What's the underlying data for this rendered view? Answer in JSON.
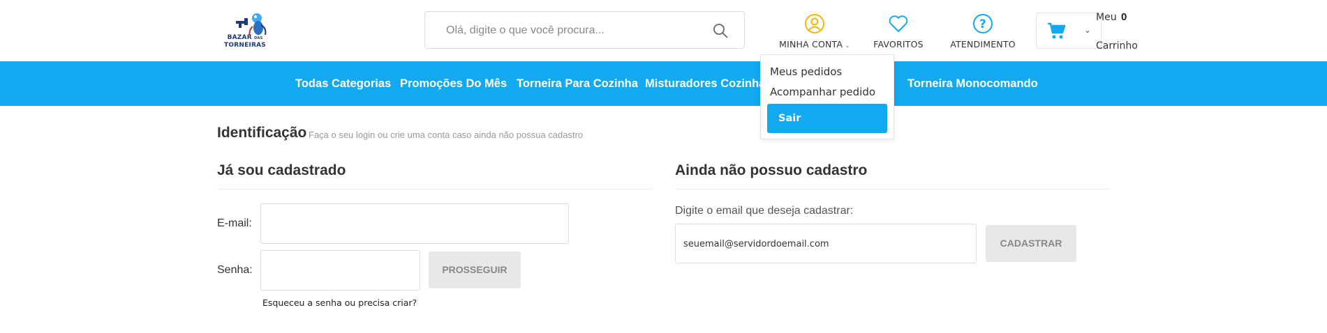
{
  "logo": {
    "line1": "BAZAR",
    "line1_small": "DAS",
    "line2": "TORNEIRAS"
  },
  "search": {
    "placeholder": "Olá, digite o que você procura..."
  },
  "header": {
    "account_label": "MINHA CONTA",
    "favorites_label": "FAVORITOS",
    "support_label": "ATENDIMENTO",
    "cart_meu": "Meu",
    "cart_count": "0",
    "cart_carrinho": "Carrinho"
  },
  "nav": [
    "Todas Categorias",
    "Promoções Do Mês",
    "Torneira Para Cozinha",
    "Misturadores Cozinha",
    "Torneira Monocomando"
  ],
  "account_menu": {
    "items": [
      "Meus pedidos",
      "Acompanhar pedido"
    ],
    "logout": "Sair"
  },
  "page": {
    "title": "Identificação",
    "subtitle": "Faça o seu login ou crie uma conta caso ainda não possua cadastro"
  },
  "login": {
    "title": "Já sou cadastrado",
    "email_label": "E-mail:",
    "password_label": "Senha:",
    "submit": "PROSSEGUIR",
    "forgot": "Esqueceu a senha ou precisa criar?"
  },
  "register": {
    "title": "Ainda não possuo cadastro",
    "description": "Digite o email que deseja cadastrar:",
    "email_value": "seuemail@servidordoemail.com",
    "submit": "CADASTRAR"
  },
  "colors": {
    "brand_blue": "#13a9f0",
    "account_icon": "#f2b600",
    "icon_blue": "#13a9f0",
    "button_gray": "#e8e8e8"
  }
}
